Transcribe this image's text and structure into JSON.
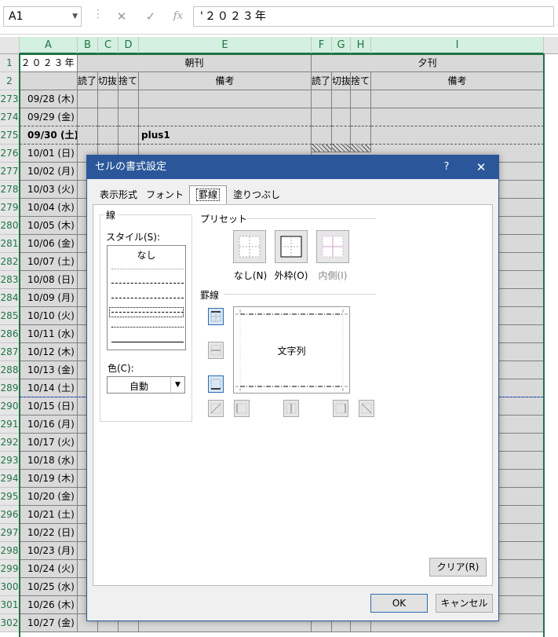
{
  "formula_bar": {
    "name_box": "A1",
    "formula": "'２０２３年",
    "cancel_icon": "✕",
    "enter_icon": "✓",
    "fx_label": "fx"
  },
  "sheet": {
    "columns": [
      "A",
      "B",
      "C",
      "D",
      "E",
      "F",
      "G",
      "H",
      "I"
    ],
    "header_row1": {
      "row": "1",
      "a1": "２０２３年",
      "morning": "朝刊",
      "evening": "夕刊"
    },
    "header_row2": {
      "row": "2",
      "read": "読了",
      "clip": "切抜",
      "discard": "捨て",
      "note": "備考",
      "read2": "読了",
      "clip2": "切抜",
      "discard2": "捨て",
      "note2": "備考"
    },
    "rows": [
      {
        "num": "273",
        "date": "09/28 (木)",
        "note": ""
      },
      {
        "num": "274",
        "date": "09/29 (金)",
        "note": ""
      },
      {
        "num": "275",
        "date": "09/30 (土)",
        "note": "plus1"
      },
      {
        "num": "276",
        "date": "10/01 (日)",
        "note": ""
      },
      {
        "num": "277",
        "date": "10/02 (月)",
        "note": ""
      },
      {
        "num": "278",
        "date": "10/03 (火)",
        "note": ""
      },
      {
        "num": "279",
        "date": "10/04 (水)",
        "note": ""
      },
      {
        "num": "280",
        "date": "10/05 (木)",
        "note": ""
      },
      {
        "num": "281",
        "date": "10/06 (金)",
        "note": ""
      },
      {
        "num": "282",
        "date": "10/07 (土)",
        "note": ""
      },
      {
        "num": "283",
        "date": "10/08 (日)",
        "note": ""
      },
      {
        "num": "284",
        "date": "10/09 (月)",
        "note": ""
      },
      {
        "num": "285",
        "date": "10/10 (火)",
        "note": ""
      },
      {
        "num": "286",
        "date": "10/11 (水)",
        "note": ""
      },
      {
        "num": "287",
        "date": "10/12 (木)",
        "note": ""
      },
      {
        "num": "288",
        "date": "10/13 (金)",
        "note": ""
      },
      {
        "num": "289",
        "date": "10/14 (土)",
        "note": ""
      },
      {
        "num": "290",
        "date": "10/15 (日)",
        "note": ""
      },
      {
        "num": "291",
        "date": "10/16 (月)",
        "note": ""
      },
      {
        "num": "292",
        "date": "10/17 (火)",
        "note": ""
      },
      {
        "num": "293",
        "date": "10/18 (水)",
        "note": ""
      },
      {
        "num": "294",
        "date": "10/19 (木)",
        "note": ""
      },
      {
        "num": "295",
        "date": "10/20 (金)",
        "note": ""
      },
      {
        "num": "296",
        "date": "10/21 (土)",
        "note": ""
      },
      {
        "num": "297",
        "date": "10/22 (日)",
        "note": ""
      },
      {
        "num": "298",
        "date": "10/23 (月)",
        "note": ""
      },
      {
        "num": "299",
        "date": "10/24 (火)",
        "note": ""
      },
      {
        "num": "300",
        "date": "10/25 (水)",
        "note": ""
      },
      {
        "num": "301",
        "date": "10/26 (木)",
        "note": ""
      },
      {
        "num": "302",
        "date": "10/27 (金)",
        "note": ""
      }
    ]
  },
  "dialog": {
    "title": "セルの書式設定",
    "help": "?",
    "close": "✕",
    "tabs": [
      {
        "label": "表示形式"
      },
      {
        "label": "フォント"
      },
      {
        "label": "罫線"
      },
      {
        "label": "塗りつぶし"
      }
    ],
    "line_group": "線",
    "style_label": "スタイル(S):",
    "style_none": "なし",
    "color_label": "色(C):",
    "color_value": "自動",
    "preset_label": "プリセット",
    "preset_none": "なし(N)",
    "preset_outline": "外枠(O)",
    "preset_inside": "内側(I)",
    "border_label": "罫線",
    "preview_text": "文字列",
    "clear_button": "クリア(R)",
    "ok_button": "OK",
    "cancel_button": "キャンセル"
  },
  "colors": {
    "accent": "#217346",
    "dialog_title": "#2b579a",
    "selected_cells": "#d9d9d9"
  }
}
